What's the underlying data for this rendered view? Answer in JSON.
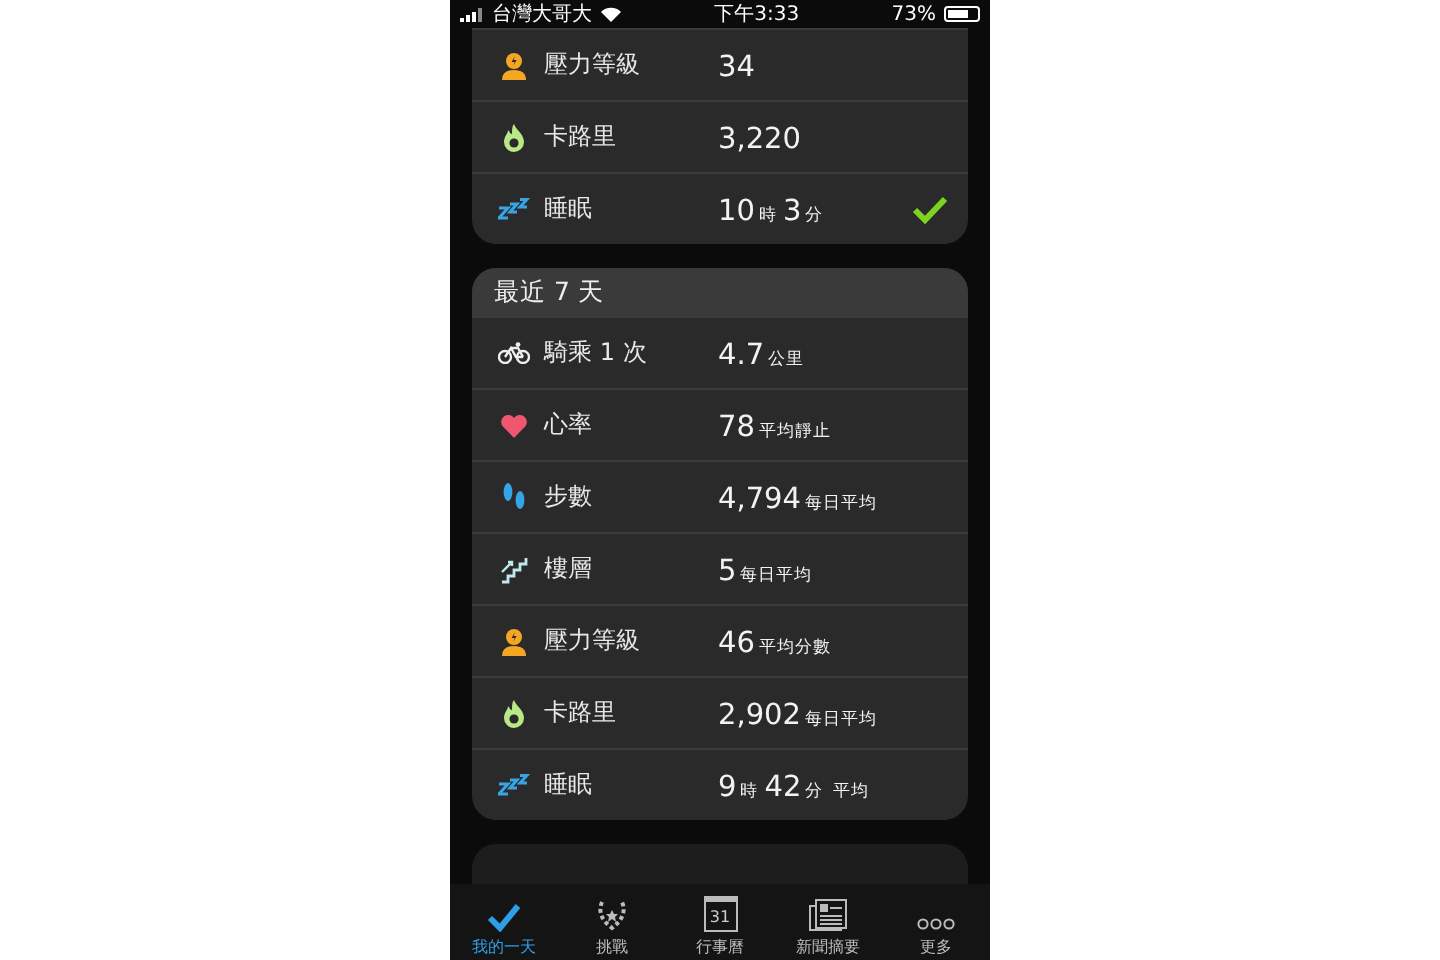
{
  "status_bar": {
    "carrier": "台灣大哥大",
    "time": "下午3:33",
    "battery": "73%"
  },
  "today_card": {
    "rows": [
      {
        "kind": "stress",
        "label": "壓力等級",
        "value": [
          {
            "text": "34",
            "kind": "big"
          }
        ],
        "done": false
      },
      {
        "kind": "calories",
        "label": "卡路里",
        "value": [
          {
            "text": "3,220",
            "kind": "big"
          }
        ],
        "done": false
      },
      {
        "kind": "sleep",
        "label": "睡眠",
        "value": [
          {
            "text": "10",
            "kind": "big"
          },
          {
            "text": "時",
            "kind": "small"
          },
          {
            "text": "3",
            "kind": "big"
          },
          {
            "text": "分",
            "kind": "small"
          }
        ],
        "done": true
      }
    ]
  },
  "week_card": {
    "title": "最近 7 天",
    "rows": [
      {
        "kind": "cycling",
        "label": "騎乘 1 次",
        "value": [
          {
            "text": "4.7",
            "kind": "big"
          },
          {
            "text": "公里",
            "kind": "small"
          }
        ],
        "done": false
      },
      {
        "kind": "heart",
        "label": "心率",
        "value": [
          {
            "text": "78",
            "kind": "big"
          },
          {
            "text": "平均靜止",
            "kind": "small"
          }
        ],
        "done": false
      },
      {
        "kind": "steps",
        "label": "步數",
        "value": [
          {
            "text": "4,794",
            "kind": "big"
          },
          {
            "text": "每日平均",
            "kind": "small"
          }
        ],
        "done": false
      },
      {
        "kind": "floors",
        "label": "樓層",
        "value": [
          {
            "text": "5",
            "kind": "big"
          },
          {
            "text": "每日平均",
            "kind": "small"
          }
        ],
        "done": false
      },
      {
        "kind": "stress",
        "label": "壓力等級",
        "value": [
          {
            "text": "46",
            "kind": "big"
          },
          {
            "text": "平均分數",
            "kind": "small"
          }
        ],
        "done": false
      },
      {
        "kind": "calories",
        "label": "卡路里",
        "value": [
          {
            "text": "2,902",
            "kind": "big"
          },
          {
            "text": "每日平均",
            "kind": "small"
          }
        ],
        "done": false
      },
      {
        "kind": "sleep",
        "label": "睡眠",
        "value": [
          {
            "text": "9",
            "kind": "big"
          },
          {
            "text": "時",
            "kind": "small"
          },
          {
            "text": "42",
            "kind": "big"
          },
          {
            "text": "分",
            "kind": "small"
          },
          {
            "text": "平均",
            "kind": "small"
          }
        ],
        "done": false
      }
    ]
  },
  "tab_bar": [
    {
      "kind": "check",
      "label": "我的一天",
      "selected": true
    },
    {
      "kind": "laurel",
      "label": "挑戰",
      "selected": false
    },
    {
      "kind": "calendar",
      "label": "行事曆",
      "day": "31",
      "selected": false
    },
    {
      "kind": "news",
      "label": "新聞摘要",
      "selected": false
    },
    {
      "kind": "more",
      "label": "更多",
      "selected": false
    }
  ]
}
